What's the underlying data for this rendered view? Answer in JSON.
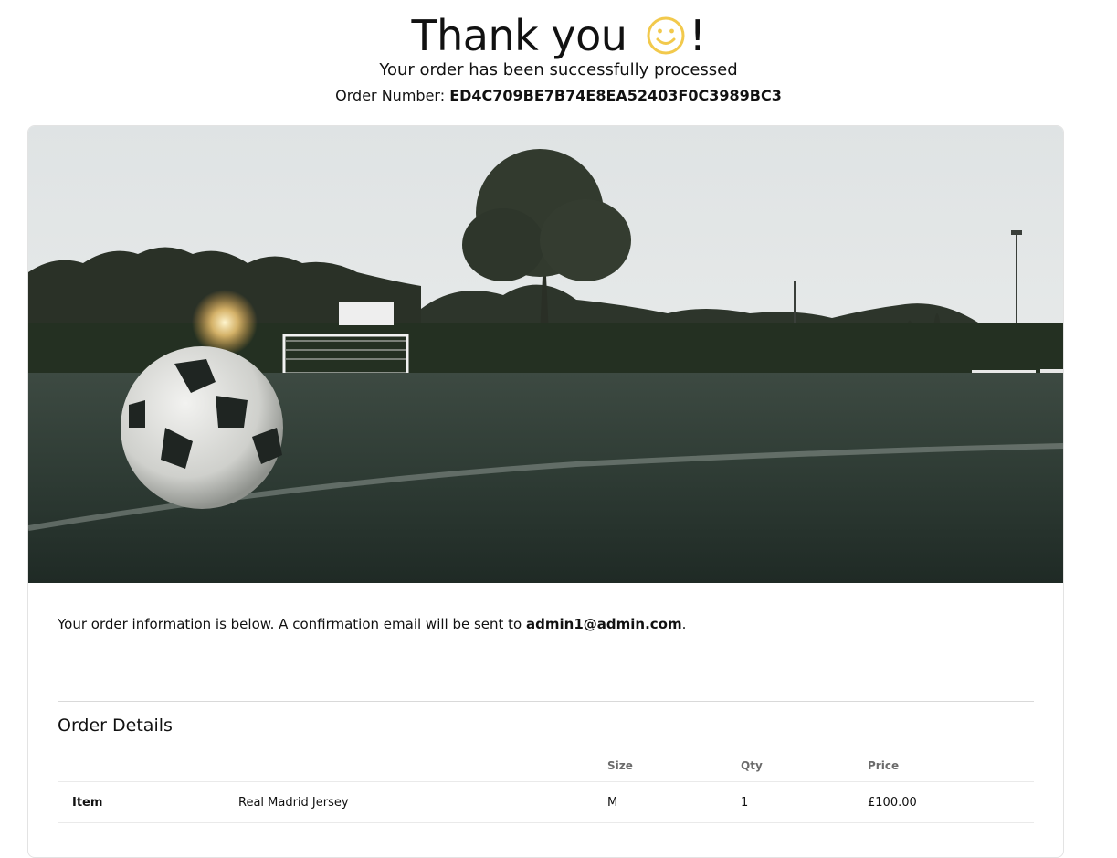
{
  "header": {
    "title": "Thank you",
    "title_suffix": "!",
    "smile_icon": "smiley-face-icon",
    "smile_color": "#f2c94c",
    "subtitle": "Your order has been successfully processed",
    "order_number_label": "Order Number:",
    "order_number": "ED4C709BE7B74E8EA52403F0C3989BC3"
  },
  "hero": {
    "image": "soccer-ball-on-field-photo"
  },
  "info": {
    "text_before": "Your order information is below. A confirmation email will be sent to",
    "email": "admin1@admin.com",
    "text_after": "."
  },
  "order_details": {
    "title": "Order Details",
    "columns": [
      "",
      "",
      "Size",
      "Qty",
      "Price"
    ],
    "rows": [
      {
        "label": "Item",
        "name": "Real Madrid Jersey",
        "size": "M",
        "qty": "1",
        "price": "£100.00"
      }
    ]
  }
}
